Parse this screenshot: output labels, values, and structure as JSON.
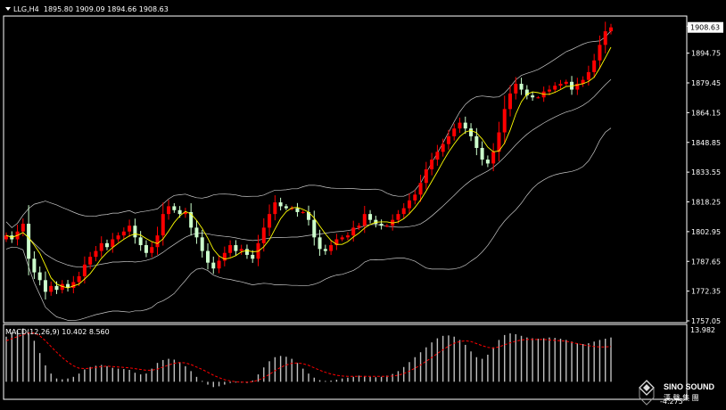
{
  "header": {
    "symbol_period": "LLG,H4",
    "ohlc": "1895.80 1909.09 1894.66 1908.63"
  },
  "chart_data": {
    "type": "candlestick",
    "price_axis": {
      "ticks": [
        1908.63,
        1894.75,
        1879.45,
        1864.15,
        1848.85,
        1833.55,
        1818.25,
        1802.95,
        1787.65,
        1772.35,
        1757.05
      ],
      "tick_labels": [
        "1908.63",
        "1894.75",
        "1879.45",
        "1864.15",
        "1848.85",
        "1833.55",
        "1818.25",
        "1802.95",
        "1787.65",
        "1772.35",
        "1757.05"
      ],
      "ylim": [
        1757.05,
        1912.0
      ],
      "current_price": "1908.63"
    },
    "overlays": [
      "bollinger-bands",
      "moving-average"
    ],
    "closes": [
      1801,
      1799,
      1803,
      1807,
      1789,
      1782,
      1778,
      1772,
      1775,
      1773,
      1776,
      1774,
      1777,
      1780,
      1786,
      1790,
      1793,
      1797,
      1795,
      1799,
      1801,
      1803,
      1806,
      1800,
      1796,
      1792,
      1795,
      1801,
      1812,
      1816,
      1814,
      1812,
      1813,
      1805,
      1800,
      1793,
      1787,
      1784,
      1788,
      1792,
      1796,
      1793,
      1794,
      1791,
      1789,
      1797,
      1805,
      1812,
      1818,
      1816,
      1815,
      1815,
      1813,
      1813,
      1809,
      1800,
      1794,
      1793,
      1796,
      1799,
      1800,
      1801,
      1805,
      1806,
      1812,
      1809,
      1807,
      1806,
      1806,
      1809,
      1812,
      1815,
      1819,
      1822,
      1828,
      1835,
      1840,
      1844,
      1848,
      1852,
      1856,
      1859,
      1856,
      1852,
      1846,
      1840,
      1838,
      1844,
      1854,
      1866,
      1874,
      1879,
      1876,
      1873,
      1872,
      1872,
      1875,
      1876,
      1878,
      1879,
      1880,
      1876,
      1879,
      1881,
      1885,
      1891,
      1899,
      1906,
      1908
    ],
    "macd": {
      "label": "MACD(12,26,9) 10.402 8.560",
      "params": "12,26,9",
      "value": 10.402,
      "signal": 8.56,
      "axis_max_label": "13.982",
      "axis_min_label": "-4.275",
      "ylim": [
        -4.275,
        13.982
      ],
      "histogram": [
        11,
        12,
        12.5,
        13,
        12,
        10,
        7,
        4,
        2,
        0.8,
        0.6,
        0.8,
        1.2,
        2,
        3,
        3.6,
        3.9,
        4.1,
        3.8,
        3.4,
        3.2,
        3.1,
        2.9,
        2.2,
        1.8,
        2,
        3.2,
        4.6,
        5.3,
        5.6,
        5.4,
        4.8,
        3.8,
        2.6,
        1.2,
        0.2,
        -0.7,
        -1.3,
        -1.1,
        -0.7,
        -0.3,
        -0.2,
        -0.2,
        -0.3,
        0.3,
        1.8,
        3.5,
        5,
        6,
        6.3,
        6.1,
        5.6,
        4.6,
        3.2,
        2,
        1,
        0.4,
        0.2,
        0.3,
        0.5,
        0.8,
        1,
        1.2,
        1.5,
        1.4,
        1.2,
        1.1,
        1.2,
        1.5,
        1.9,
        2.6,
        3.6,
        4.8,
        6,
        7.2,
        8.4,
        9.6,
        10.6,
        11.2,
        11.3,
        11,
        10.2,
        9,
        7.4,
        6,
        5.6,
        6.6,
        8.4,
        10.2,
        11.4,
        11.8,
        11.6,
        11.2,
        10.8,
        10.6,
        10.5,
        10.6,
        10.8,
        10.7,
        10.5,
        10.2,
        9.8,
        9.4,
        9.2,
        9.4,
        9.8,
        10.2,
        10.5,
        10.8
      ],
      "signal_series": [
        10,
        10.5,
        11,
        11.5,
        11.9,
        11.9,
        11.2,
        10,
        8.6,
        7.2,
        5.9,
        4.8,
        3.9,
        3.3,
        3.2,
        3.3,
        3.5,
        3.7,
        3.8,
        3.7,
        3.6,
        3.5,
        3.4,
        3.2,
        3,
        2.8,
        2.8,
        3.1,
        3.6,
        4.1,
        4.5,
        4.7,
        4.6,
        4.2,
        3.6,
        3,
        2.3,
        1.6,
        1,
        0.5,
        0.2,
        0,
        -0.1,
        -0.1,
        0,
        0.4,
        1,
        1.8,
        2.7,
        3.5,
        4.1,
        4.5,
        4.6,
        4.4,
        4,
        3.4,
        2.8,
        2.3,
        1.9,
        1.6,
        1.4,
        1.3,
        1.3,
        1.3,
        1.3,
        1.3,
        1.3,
        1.3,
        1.3,
        1.4,
        1.6,
        2,
        2.6,
        3.3,
        4.1,
        5,
        5.9,
        6.9,
        7.8,
        8.7,
        9.4,
        9.8,
        10,
        9.8,
        9.3,
        8.8,
        8.4,
        8.2,
        8.5,
        9,
        9.5,
        9.9,
        10.2,
        10.3,
        10.3,
        10.3,
        10.3,
        10.2,
        10.1,
        10,
        9.9,
        9.6,
        9.3,
        9,
        8.8,
        8.6,
        8.5,
        8.5,
        8.56
      ]
    }
  },
  "watermark": {
    "brand": "SINO SOUND",
    "sub": "漢 聲 集 團"
  },
  "colors": {
    "background": "#000000",
    "bull": "#ff0000",
    "bear": "#ccffcc",
    "bands": "#c8c8c8",
    "ma": "#ffff00",
    "macd_signal": "#ff0000",
    "histogram": "#c0c0c0",
    "frame": "#ffffff"
  }
}
